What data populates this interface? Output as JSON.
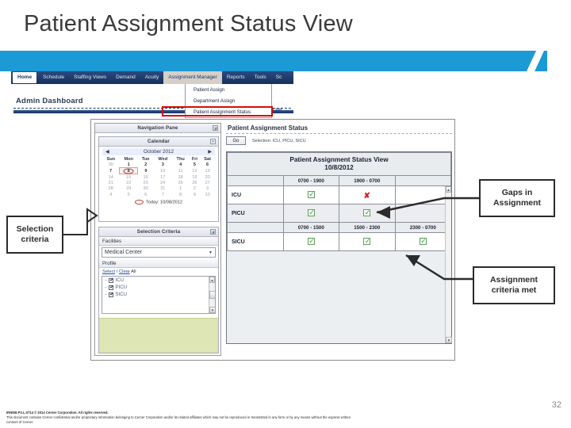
{
  "slide": {
    "title": "Patient Assignment Status View",
    "page_number": "32",
    "banner_color": "#1b9ad6"
  },
  "app": {
    "nav_items": [
      {
        "label": "Home",
        "state": "active"
      },
      {
        "label": "Schedule",
        "state": "normal"
      },
      {
        "label": "Staffing Views",
        "state": "normal"
      },
      {
        "label": "Demand",
        "state": "normal"
      },
      {
        "label": "Acuity",
        "state": "normal"
      },
      {
        "label": "Assignment Manager",
        "state": "open"
      },
      {
        "label": "Reports",
        "state": "normal"
      },
      {
        "label": "Tools",
        "state": "normal"
      },
      {
        "label": "Sc",
        "state": "normal"
      }
    ],
    "dropdown": {
      "items": [
        "Patient Assign",
        "Department Assign",
        "Patient Assignment Status"
      ],
      "highlighted_index": 2,
      "highlight_color": "#d40d0d"
    },
    "dashboard_title": "Admin Dashboard",
    "current_label": "Curr"
  },
  "navigation_pane": {
    "title": "Navigation Pane",
    "collapse_icon": "collapse-icon",
    "calendar": {
      "title": "Calendar",
      "close_icon": "close-icon",
      "prev_arrow": "◀",
      "next_arrow": "▶",
      "month_label": "October 2012",
      "day_headers": [
        "Sun",
        "Mon",
        "Tue",
        "Wed",
        "Thu",
        "Fri",
        "Sat"
      ],
      "weeks": [
        [
          {
            "d": "30",
            "t": "other"
          },
          {
            "d": "1",
            "t": "cur"
          },
          {
            "d": "2",
            "t": "cur"
          },
          {
            "d": "3",
            "t": "cur"
          },
          {
            "d": "4",
            "t": "cur"
          },
          {
            "d": "5",
            "t": "cur"
          },
          {
            "d": "6",
            "t": "cur"
          }
        ],
        [
          {
            "d": "7",
            "t": "cur"
          },
          {
            "d": "8",
            "t": "today"
          },
          {
            "d": "9",
            "t": "cur"
          },
          {
            "d": "10",
            "t": "other"
          },
          {
            "d": "11",
            "t": "other"
          },
          {
            "d": "12",
            "t": "other"
          },
          {
            "d": "13",
            "t": "other"
          }
        ],
        [
          {
            "d": "14",
            "t": "other"
          },
          {
            "d": "15",
            "t": "other"
          },
          {
            "d": "16",
            "t": "other"
          },
          {
            "d": "17",
            "t": "other"
          },
          {
            "d": "18",
            "t": "other"
          },
          {
            "d": "19",
            "t": "other"
          },
          {
            "d": "20",
            "t": "other"
          }
        ],
        [
          {
            "d": "21",
            "t": "other"
          },
          {
            "d": "22",
            "t": "other"
          },
          {
            "d": "23",
            "t": "other"
          },
          {
            "d": "24",
            "t": "other"
          },
          {
            "d": "25",
            "t": "other"
          },
          {
            "d": "26",
            "t": "other"
          },
          {
            "d": "27",
            "t": "other"
          }
        ],
        [
          {
            "d": "28",
            "t": "other"
          },
          {
            "d": "29",
            "t": "other"
          },
          {
            "d": "30",
            "t": "other"
          },
          {
            "d": "31",
            "t": "other"
          },
          {
            "d": "1",
            "t": "other"
          },
          {
            "d": "2",
            "t": "other"
          },
          {
            "d": "3",
            "t": "other"
          }
        ],
        [
          {
            "d": "4",
            "t": "other"
          },
          {
            "d": "5",
            "t": "other"
          },
          {
            "d": "6",
            "t": "other"
          },
          {
            "d": "7",
            "t": "other"
          },
          {
            "d": "8",
            "t": "other"
          },
          {
            "d": "9",
            "t": "other"
          },
          {
            "d": "10",
            "t": "other"
          }
        ]
      ],
      "today_label": "Today: 10/08/2012"
    },
    "selection_criteria": {
      "title": "Selection Criteria",
      "collapse_icon": "collapse-icon",
      "facilities_label": "Facilities",
      "facilities_value": "Medical Center",
      "profile_label": "Profile",
      "select_link": "Select",
      "separator": " / ",
      "clear_link": "Clear",
      "all_text": " All",
      "profiles": [
        {
          "label": "ICU",
          "checked": true
        },
        {
          "label": "PICU",
          "checked": true
        },
        {
          "label": "SICU",
          "checked": true
        }
      ]
    }
  },
  "status_panel": {
    "heading": "Patient Assignment Status",
    "go_button": "Go",
    "selection_text": "Selection: ICU, PICU, SICU",
    "view_title": "Patient Assignment Status View",
    "view_date": "10/8/2012",
    "group_a": {
      "shift_headers": [
        "0700 - 1900",
        "1900 - 0700"
      ],
      "rows": [
        {
          "unit": "ICU",
          "marks": [
            "check",
            "x"
          ]
        },
        {
          "unit": "PICU",
          "marks": [
            "check",
            "check"
          ]
        }
      ]
    },
    "group_b": {
      "shift_headers": [
        "0700 - 1500",
        "1500 - 2300",
        "2300 - 0700"
      ],
      "rows": [
        {
          "unit": "SICU",
          "marks": [
            "check",
            "check",
            "check"
          ]
        }
      ]
    },
    "mark_colors": {
      "check": "#2e9e2e",
      "x": "#d62020"
    }
  },
  "callouts": {
    "selection_criteria": "Selection\ncriteria",
    "selection_criteria_line1": "Selection",
    "selection_criteria_line2": "criteria",
    "gaps_line1": "Gaps in",
    "gaps_line2": "Assignment",
    "met_line1": "Assignment",
    "met_line2": "criteria met"
  },
  "footer": {
    "line1": "IRNDB:P2.L.0714   © 2014 Cerner Corporation. All rights reserved.",
    "line2": "This document contains Cerner confidential and/or proprietary information belonging to Cerner Corporation and/or its related affiliates which may not be reproduced or transmitted in any form or by any means without the express written",
    "line3": "consent of Cerner."
  }
}
